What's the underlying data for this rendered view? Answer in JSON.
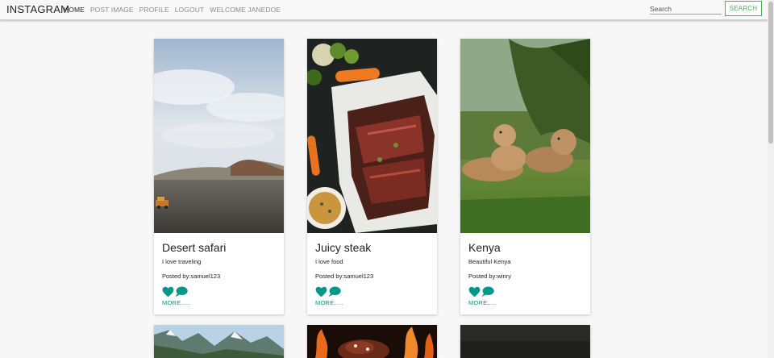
{
  "navbar": {
    "brand": "INSTAGRAM",
    "links": [
      {
        "label": "HOME"
      },
      {
        "label": "POST IMAGE"
      },
      {
        "label": "PROFILE"
      },
      {
        "label": "LOGOUT"
      },
      {
        "label": "WELCOME JANEDOE"
      }
    ],
    "search_placeholder": "Search",
    "search_button": "SEARCH"
  },
  "posts": [
    {
      "title": "Desert safari",
      "description": "I love traveling",
      "posted_by": "Posted by:samuel123",
      "more": "MORE.....",
      "icons": [
        "heart-icon",
        "comment-icon"
      ]
    },
    {
      "title": "Juicy steak",
      "description": "I love food",
      "posted_by": "Posted by:samuel123",
      "more": "MORE.....",
      "icons": [
        "heart-icon",
        "comment-icon"
      ]
    },
    {
      "title": "Kenya",
      "description": "Beautiful Kenya",
      "posted_by": "Posted by:winry",
      "more": "MORE.....",
      "icons": [
        "heart-icon",
        "comment-icon"
      ]
    }
  ],
  "colors": {
    "accent": "#009688",
    "search_button": "#4caf50"
  }
}
